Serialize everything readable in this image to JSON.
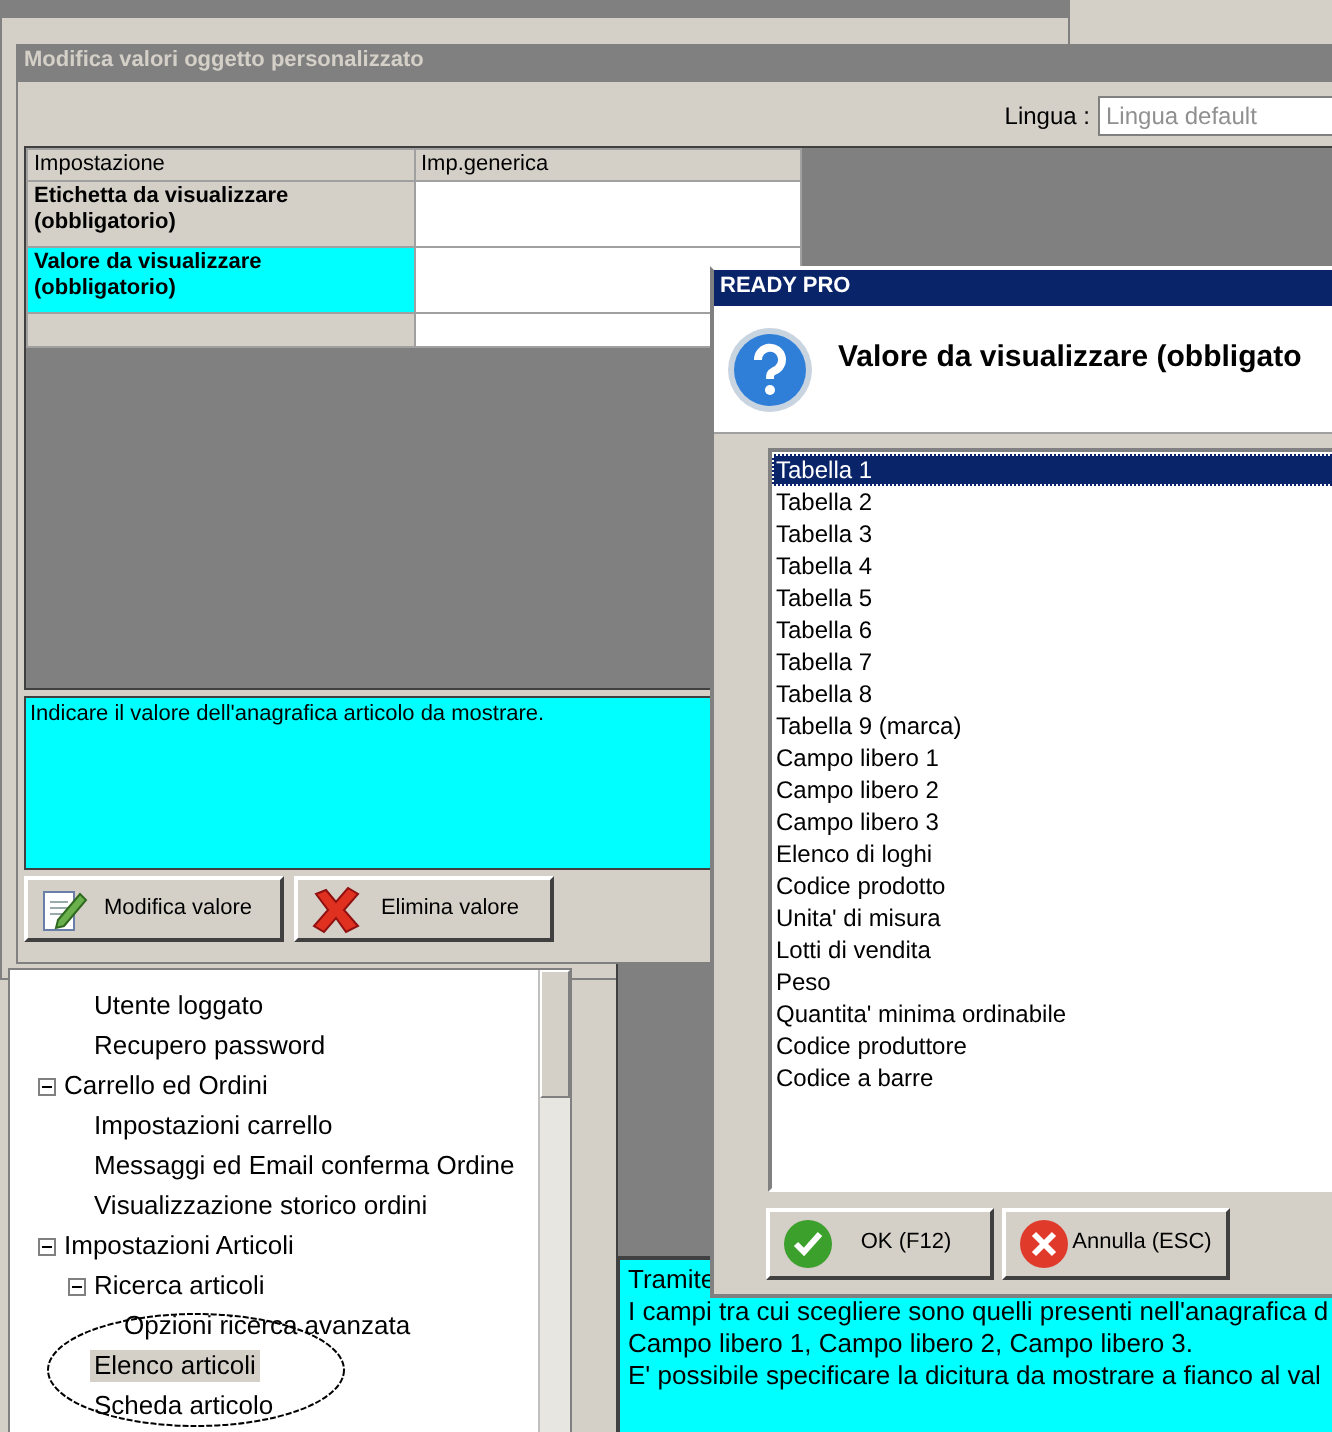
{
  "editor_window": {
    "title": "Modifica valori oggetto personalizzato",
    "language_label": "Lingua :",
    "language_field": {
      "placeholder": "Lingua default"
    },
    "grid": {
      "columns": [
        "Impostazione",
        "Imp.generica"
      ],
      "rows": [
        {
          "setting": "Etichetta da visualizzare (obbligatorio)",
          "selected": false
        },
        {
          "setting": "Valore da visualizzare (obbligatorio)",
          "selected": true
        },
        {
          "selected": false
        }
      ]
    },
    "description": "Indicare il valore dell'anagrafica articolo da mostrare.",
    "buttons": [
      {
        "label": "Modifica valore",
        "kind": "edit"
      },
      {
        "label": "Elimina valore",
        "kind": "delete"
      }
    ]
  },
  "tree": {
    "items": [
      {
        "children": [
          {
            "label": "Utente loggato",
            "selected": false
          },
          {
            "label": "Recupero password",
            "selected": false
          }
        ]
      },
      {
        "label": "Carrello ed Ordini",
        "expanded": true,
        "selected": false,
        "children": [
          {
            "label": "Impostazioni carrello",
            "selected": false
          },
          {
            "label": "Messaggi ed Email conferma Ordine",
            "selected": false
          },
          {
            "label": "Visualizzazione storico ordini",
            "selected": false
          }
        ]
      },
      {
        "label": "Impostazioni Articoli",
        "expanded": true,
        "selected": false,
        "children": [
          {
            "label": "Ricerca articoli",
            "expanded": true,
            "selected": false,
            "children": [
              {
                "label": "Opzioni ricerca avanzata",
                "selected": false
              }
            ]
          },
          {
            "label": "Elenco articoli",
            "selected": true
          },
          {
            "label": "Scheda articolo",
            "selected": false
          }
        ]
      }
    ]
  },
  "help_text": {
    "lines": [
      "Tramite",
      "I campi tra cui scegliere sono quelli presenti nell'anagrafica d",
      "Campo libero 1, Campo libero 2, Campo libero 3.",
      "E' possibile specificare la dicitura da mostrare a fianco al val"
    ]
  },
  "dialog": {
    "title": "READY PRO",
    "heading": "Valore da visualizzare (obbligato",
    "options": [
      {
        "label": "Tabella 1",
        "selected": true
      },
      {
        "label": "Tabella 2",
        "selected": false
      },
      {
        "label": "Tabella 3",
        "selected": false
      },
      {
        "label": "Tabella 4",
        "selected": false
      },
      {
        "label": "Tabella 5",
        "selected": false
      },
      {
        "label": "Tabella 6",
        "selected": false
      },
      {
        "label": "Tabella 7",
        "selected": false
      },
      {
        "label": "Tabella 8",
        "selected": false
      },
      {
        "label": "Tabella 9 (marca)",
        "selected": false
      },
      {
        "label": "Campo libero 1",
        "selected": false
      },
      {
        "label": "Campo libero 2",
        "selected": false
      },
      {
        "label": "Campo libero 3",
        "selected": false
      },
      {
        "label": "Elenco di loghi",
        "selected": false
      },
      {
        "label": "Codice prodotto",
        "selected": false
      },
      {
        "label": "Unita' di misura",
        "selected": false
      },
      {
        "label": "Lotti di vendita",
        "selected": false
      },
      {
        "label": "Peso",
        "selected": false
      },
      {
        "label": "Quantita' minima ordinabile",
        "selected": false
      },
      {
        "label": "Codice produttore",
        "selected": false
      },
      {
        "label": "Codice a barre",
        "selected": false
      }
    ],
    "buttons": [
      {
        "label": "OK (F12)",
        "kind": "ok"
      },
      {
        "label": "Annulla (ESC)",
        "kind": "cancel"
      }
    ]
  }
}
